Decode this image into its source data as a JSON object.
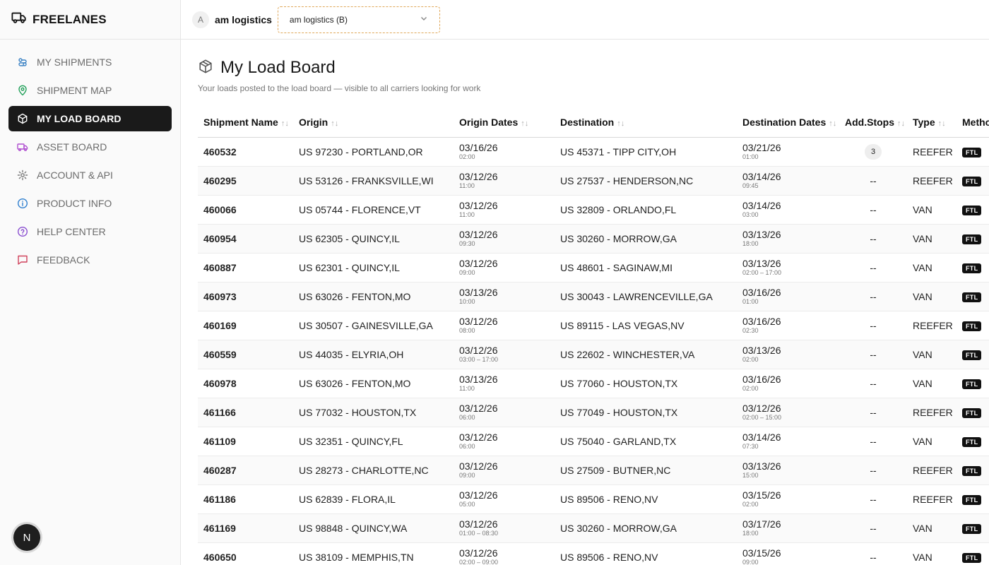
{
  "brand": {
    "name": "FREELANES"
  },
  "sidebar": {
    "items": [
      {
        "label": "MY SHIPMENTS",
        "icon": "route-icon",
        "color": "#3b82c4",
        "active": false
      },
      {
        "label": "SHIPMENT MAP",
        "icon": "map-pin-icon",
        "color": "#22a05a",
        "active": false
      },
      {
        "label": "MY LOAD BOARD",
        "icon": "package-icon",
        "color": "#ffffff",
        "active": true
      },
      {
        "label": "ASSET BOARD",
        "icon": "truck-icon",
        "color": "#b04fd0",
        "active": false
      },
      {
        "label": "ACCOUNT & API",
        "icon": "gear-icon",
        "color": "#777777",
        "active": false
      },
      {
        "label": "PRODUCT INFO",
        "icon": "info-icon",
        "color": "#2f7fcf",
        "active": false
      },
      {
        "label": "HELP CENTER",
        "icon": "help-circle-icon",
        "color": "#8a4fd0",
        "active": false
      },
      {
        "label": "FEEDBACK",
        "icon": "message-icon",
        "color": "#d0405a",
        "active": false
      }
    ],
    "fab_label": "N"
  },
  "topbar": {
    "avatar_letter": "A",
    "company_name": "am logistics",
    "company_select_value": "am logistics (B)"
  },
  "main": {
    "title": "My Load Board",
    "subtitle": "Your loads posted to the load board — visible to all carriers looking for work"
  },
  "table": {
    "headers": {
      "name": "Shipment Name",
      "origin": "Origin",
      "origin_dates": "Origin Dates",
      "destination": "Destination",
      "dest_dates": "Destination Dates",
      "stops": "Add.Stops",
      "type": "Type",
      "method": "Metho"
    },
    "sort_glyph": "↑↓",
    "rows": [
      {
        "name": "460532",
        "origin": "US 97230 - PORTLAND,OR",
        "od": "03/16/26",
        "ot": "02:00",
        "dest": "US 45371 - TIPP CITY,OH",
        "dd": "03/21/26",
        "dt": "01:00",
        "stops": "3",
        "type": "REEFER",
        "method": "FTL"
      },
      {
        "name": "460295",
        "origin": "US 53126 - FRANKSVILLE,WI",
        "od": "03/12/26",
        "ot": "11:00",
        "dest": "US 27537 - HENDERSON,NC",
        "dd": "03/14/26",
        "dt": "09:45",
        "stops": "--",
        "type": "REEFER",
        "method": "FTL"
      },
      {
        "name": "460066",
        "origin": "US 05744 - FLORENCE,VT",
        "od": "03/12/26",
        "ot": "11:00",
        "dest": "US 32809 - ORLANDO,FL",
        "dd": "03/14/26",
        "dt": "03:00",
        "stops": "--",
        "type": "VAN",
        "method": "FTL"
      },
      {
        "name": "460954",
        "origin": "US 62305 - QUINCY,IL",
        "od": "03/12/26",
        "ot": "09:30",
        "dest": "US 30260 - MORROW,GA",
        "dd": "03/13/26",
        "dt": "18:00",
        "stops": "--",
        "type": "VAN",
        "method": "FTL"
      },
      {
        "name": "460887",
        "origin": "US 62301 - QUINCY,IL",
        "od": "03/12/26",
        "ot": "09:00",
        "dest": "US 48601 - SAGINAW,MI",
        "dd": "03/13/26",
        "dt": "02:00 – 17:00",
        "stops": "--",
        "type": "VAN",
        "method": "FTL"
      },
      {
        "name": "460973",
        "origin": "US 63026 - FENTON,MO",
        "od": "03/13/26",
        "ot": "10:00",
        "dest": "US 30043 - LAWRENCEVILLE,GA",
        "dd": "03/16/26",
        "dt": "01:00",
        "stops": "--",
        "type": "VAN",
        "method": "FTL"
      },
      {
        "name": "460169",
        "origin": "US 30507 - GAINESVILLE,GA",
        "od": "03/12/26",
        "ot": "08:00",
        "dest": "US 89115 - LAS VEGAS,NV",
        "dd": "03/16/26",
        "dt": "02:30",
        "stops": "--",
        "type": "REEFER",
        "method": "FTL"
      },
      {
        "name": "460559",
        "origin": "US 44035 - ELYRIA,OH",
        "od": "03/12/26",
        "ot": "03:00 – 17:00",
        "dest": "US 22602 - WINCHESTER,VA",
        "dd": "03/13/26",
        "dt": "02:00",
        "stops": "--",
        "type": "VAN",
        "method": "FTL"
      },
      {
        "name": "460978",
        "origin": "US 63026 - FENTON,MO",
        "od": "03/13/26",
        "ot": "11:00",
        "dest": "US 77060 - HOUSTON,TX",
        "dd": "03/16/26",
        "dt": "02:00",
        "stops": "--",
        "type": "VAN",
        "method": "FTL"
      },
      {
        "name": "461166",
        "origin": "US 77032 - HOUSTON,TX",
        "od": "03/12/26",
        "ot": "06:00",
        "dest": "US 77049 - HOUSTON,TX",
        "dd": "03/12/26",
        "dt": "02:00 – 15:00",
        "stops": "--",
        "type": "REEFER",
        "method": "FTL"
      },
      {
        "name": "461109",
        "origin": "US 32351 - QUINCY,FL",
        "od": "03/12/26",
        "ot": "06:00",
        "dest": "US 75040 - GARLAND,TX",
        "dd": "03/14/26",
        "dt": "07:30",
        "stops": "--",
        "type": "VAN",
        "method": "FTL"
      },
      {
        "name": "460287",
        "origin": "US 28273 - CHARLOTTE,NC",
        "od": "03/12/26",
        "ot": "09:00",
        "dest": "US 27509 - BUTNER,NC",
        "dd": "03/13/26",
        "dt": "15:00",
        "stops": "--",
        "type": "REEFER",
        "method": "FTL"
      },
      {
        "name": "461186",
        "origin": "US 62839 - FLORA,IL",
        "od": "03/12/26",
        "ot": "05:00",
        "dest": "US 89506 - RENO,NV",
        "dd": "03/15/26",
        "dt": "02:00",
        "stops": "--",
        "type": "REEFER",
        "method": "FTL"
      },
      {
        "name": "461169",
        "origin": "US 98848 - QUINCY,WA",
        "od": "03/12/26",
        "ot": "01:00 – 08:30",
        "dest": "US 30260 - MORROW,GA",
        "dd": "03/17/26",
        "dt": "18:00",
        "stops": "--",
        "type": "VAN",
        "method": "FTL"
      },
      {
        "name": "460650",
        "origin": "US 38109 - MEMPHIS,TN",
        "od": "03/12/26",
        "ot": "02:00 – 09:00",
        "dest": "US 89506 - RENO,NV",
        "dd": "03/15/26",
        "dt": "09:00",
        "stops": "--",
        "type": "VAN",
        "method": "FTL"
      }
    ]
  }
}
